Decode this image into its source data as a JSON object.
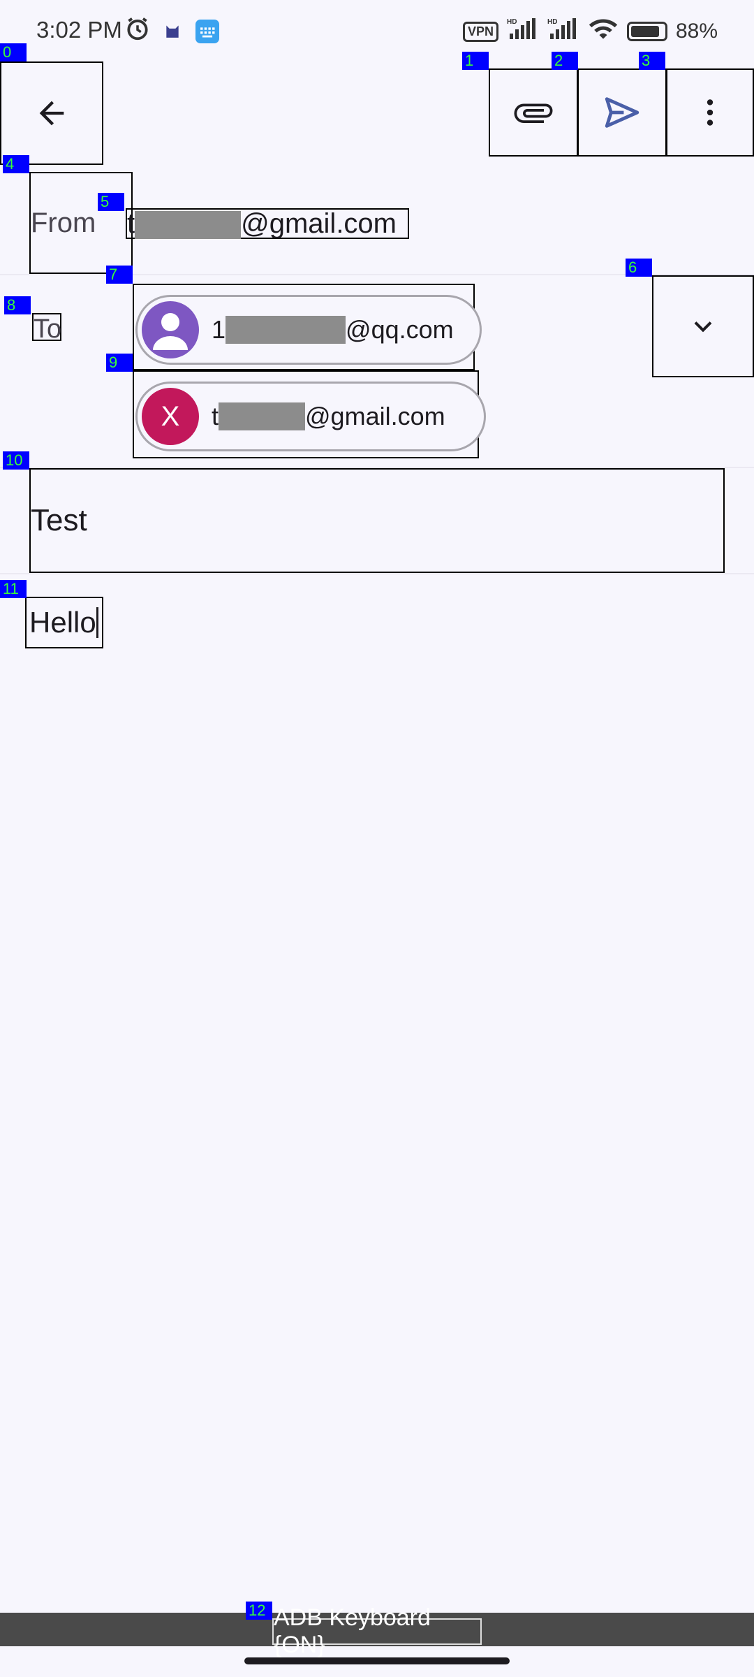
{
  "status_bar": {
    "time": "3:02 PM",
    "vpn": "VPN",
    "battery_percent": "88%",
    "battery_level": 0.88,
    "icons": [
      "alarm-icon",
      "cat-icon",
      "keyboard-icon",
      "vpn-icon",
      "signal-hd-icon",
      "signal-hd-icon",
      "wifi-icon",
      "battery-icon"
    ]
  },
  "toolbar": {
    "back_icon": "arrow-left-icon",
    "attach_icon": "paperclip-icon",
    "send_icon": "send-icon",
    "more_icon": "more-vertical-icon"
  },
  "compose": {
    "from_label": "From",
    "from_address_prefix": "t",
    "from_address_suffix": "@gmail.com",
    "to_label": "To",
    "recipients": [
      {
        "prefix": "1",
        "suffix": "@qq.com",
        "avatar": "person-icon",
        "avatar_color": "#7e57c2"
      },
      {
        "prefix": "t",
        "suffix": "@gmail.com",
        "avatar_letter": "X",
        "avatar_color": "#c2185b"
      }
    ],
    "expand_icon": "chevron-down-icon",
    "subject": "Test",
    "body": "Hello"
  },
  "keyboard_bar": {
    "label": "ADB Keyboard {ON}"
  },
  "overlay_tags": [
    "0",
    "1",
    "2",
    "3",
    "4",
    "5",
    "6",
    "7",
    "8",
    "9",
    "10",
    "11",
    "12"
  ],
  "colors": {
    "accent": "#4a5fa8",
    "background": "#f7f6fd",
    "tag_bg": "#0000ff",
    "tag_text": "#39ff39"
  }
}
